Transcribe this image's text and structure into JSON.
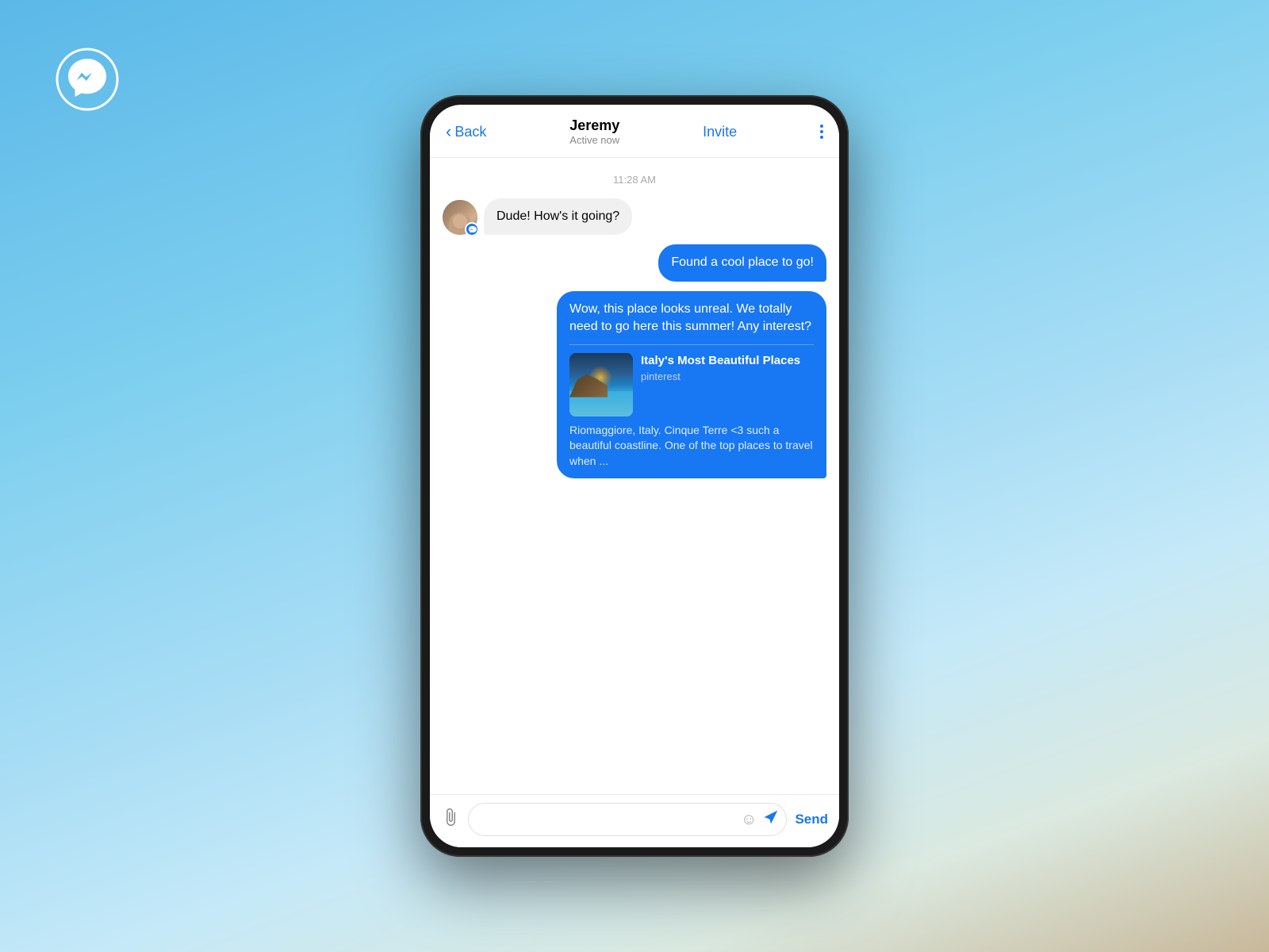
{
  "background": {
    "description": "Blue sky gradient background"
  },
  "messenger_icon": {
    "label": "Facebook Messenger"
  },
  "header": {
    "back_label": "Back",
    "contact_name": "Jeremy",
    "contact_status": "Active now",
    "invite_label": "Invite",
    "more_label": "More options"
  },
  "messages": {
    "timestamp": "11:28 AM",
    "incoming_1": {
      "text": "Dude! How's it going?",
      "sender": "Jeremy"
    },
    "outgoing_1": {
      "text": "Found a cool place to go!"
    },
    "outgoing_2": {
      "text": "Wow, this place looks unreal. We totally need to go here this summer! Any interest?",
      "link_title": "Italy's Most Beautiful Places",
      "link_source": "pinterest",
      "link_desc": "Riomaggiore, Italy. Cinque Terre <3 such a beautiful coastline. One of the top places to travel when ..."
    }
  },
  "input_bar": {
    "placeholder": "",
    "send_label": "Send"
  }
}
